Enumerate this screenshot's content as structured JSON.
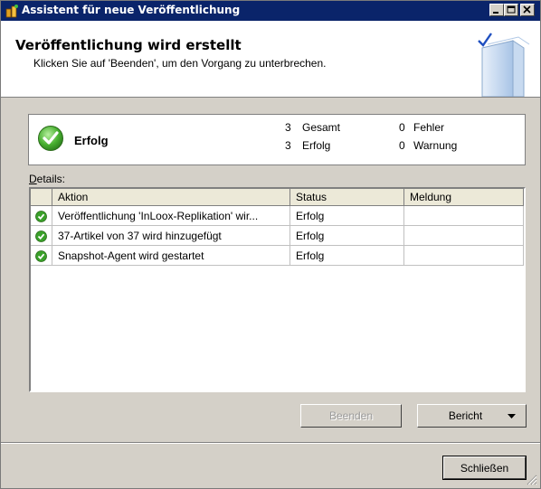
{
  "window": {
    "title": "Assistent für neue Veröffentlichung"
  },
  "header": {
    "title": "Veröffentlichung wird erstellt",
    "subtitle": "Klicken Sie auf 'Beenden', um den Vorgang zu unterbrechen."
  },
  "summary": {
    "status": "Erfolg",
    "total_count": "3",
    "total_label": "Gesamt",
    "success_count": "3",
    "success_label": "Erfolg",
    "error_count": "0",
    "error_label": "Fehler",
    "warning_count": "0",
    "warning_label": "Warnung"
  },
  "details": {
    "label_prefix": "D",
    "label_rest": "etails:",
    "columns": [
      "Aktion",
      "Status",
      "Meldung"
    ],
    "rows": [
      {
        "action": "Veröffentlichung 'InLoox-Replikation' wir...",
        "status": "Erfolg",
        "message": ""
      },
      {
        "action": "37-Artikel von 37 wird hinzugefügt",
        "status": "Erfolg",
        "message": ""
      },
      {
        "action": "Snapshot-Agent wird gestartet",
        "status": "Erfolg",
        "message": ""
      }
    ]
  },
  "buttons": {
    "stop_label": "Beenden",
    "report_label": "Bericht",
    "close_label": "Schließen"
  },
  "colors": {
    "titlebar": "#0a246a",
    "success_green": "#3aa02a"
  },
  "icons": [
    "app-icon",
    "minimize-icon",
    "maximize-icon",
    "close-icon",
    "wizard-book-icon",
    "success-check-icon",
    "dropdown-arrow-icon",
    "resize-grip-icon"
  ]
}
